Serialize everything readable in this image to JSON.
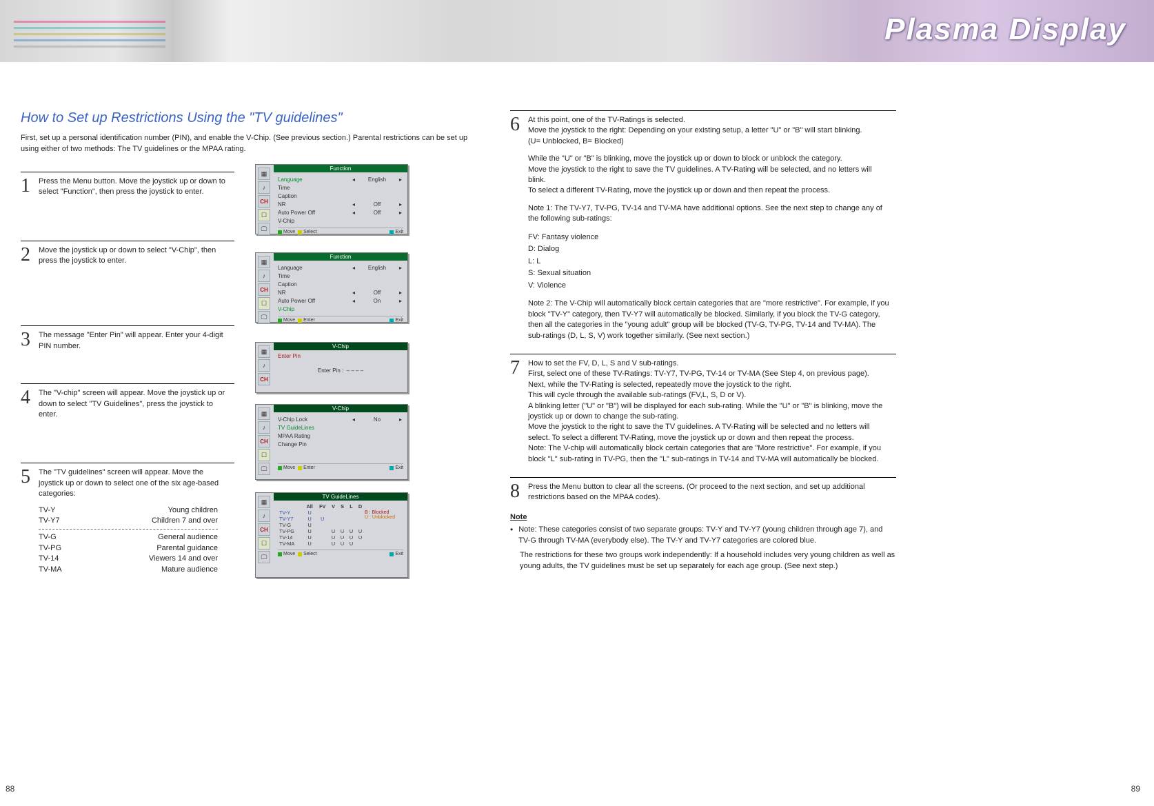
{
  "banner": {
    "title": "Plasma Display"
  },
  "page_left_num": "88",
  "page_right_num": "89",
  "heading": "How to Set up Restrictions Using the \"TV guidelines\"",
  "intro": "First, set up a personal identification number (PIN), and enable the V-Chip. (See previous section.) Parental restrictions can be set up using either of two methods: The TV guidelines or the MPAA rating.",
  "steps": {
    "1": "Press the Menu button. Move the joystick up or down to select \"Function\", then press the joystick to enter.",
    "2": "Move the joystick up or down to select \"V-Chip\", then press the joystick to enter.",
    "3": "The message \"Enter Pin\" will appear. Enter your 4-digit PIN number.",
    "4": "The \"V-chip\" screen will appear. Move the joystick up or down to select \"TV Guidelines\", press the joystick to enter.",
    "5": "The \"TV guidelines\" screen will appear. Move the joystick up or down to select one of the six age-based categories:"
  },
  "ratings": [
    {
      "code": "TV-Y",
      "label": "Young children"
    },
    {
      "code": "TV-Y7",
      "label": "Children 7 and over"
    },
    {
      "code": "TV-G",
      "label": "General audience"
    },
    {
      "code": "TV-PG",
      "label": "Parental guidance"
    },
    {
      "code": "TV-14",
      "label": "Viewers 14 and over"
    },
    {
      "code": "TV-MA",
      "label": "Mature audience"
    }
  ],
  "osd": {
    "icons": {
      "pic": "▦",
      "sound": "♪",
      "ch": "CH",
      "setup": "☐",
      "pc": "🖵"
    },
    "foot": {
      "move": "Move",
      "select": "Select",
      "enter": "Enter",
      "exit": "Exit"
    },
    "func_title": "Function",
    "vchip_title": "V-Chip",
    "guidelines_title": "TV GuideLines",
    "m1": {
      "rows": [
        {
          "lab": "Language",
          "val": "English",
          "hl": true
        },
        {
          "lab": "Time",
          "val": ""
        },
        {
          "lab": "Caption",
          "val": ""
        },
        {
          "lab": "NR",
          "val": "Off"
        },
        {
          "lab": "Auto Power Off",
          "val": "Off"
        },
        {
          "lab": "V-Chip",
          "val": ""
        }
      ]
    },
    "m2": {
      "rows": [
        {
          "lab": "Language",
          "val": "English"
        },
        {
          "lab": "Time",
          "val": ""
        },
        {
          "lab": "Caption",
          "val": ""
        },
        {
          "lab": "NR",
          "val": "Off"
        },
        {
          "lab": "Auto Power Off",
          "val": "On"
        },
        {
          "lab": "V-Chip",
          "val": "",
          "hl": true
        }
      ]
    },
    "m3": {
      "title_tag": "Enter Pin",
      "label": "Enter Pin   :",
      "value": "– – – –"
    },
    "m4": {
      "rows": [
        {
          "lab": "V-Chip Lock",
          "val": "No"
        },
        {
          "lab": "TV GuideLines",
          "val": "",
          "hl": true
        },
        {
          "lab": "MPAA Rating",
          "val": ""
        },
        {
          "lab": "Change Pin",
          "val": ""
        }
      ]
    },
    "m5": {
      "cols": [
        "",
        "All",
        "FV",
        "V",
        "S",
        "L",
        "D"
      ],
      "key_b": "B  : Blocked",
      "key_u": "U  : Unblocked",
      "rows": [
        {
          "r": "TV-Y",
          "all": "U",
          "fv": "",
          "v": "",
          "s": "",
          "l": "",
          "d": "",
          "blue": true
        },
        {
          "r": "TV-Y7",
          "all": "U",
          "fv": "U",
          "v": "",
          "s": "",
          "l": "",
          "d": "",
          "blue": true
        },
        {
          "r": "TV-G",
          "all": "U",
          "fv": "",
          "v": "",
          "s": "",
          "l": "",
          "d": ""
        },
        {
          "r": "TV-PG",
          "all": "U",
          "fv": "",
          "v": "U",
          "s": "U",
          "l": "U",
          "d": "U"
        },
        {
          "r": "TV-14",
          "all": "U",
          "fv": "",
          "v": "U",
          "s": "U",
          "l": "U",
          "d": "U"
        },
        {
          "r": "TV-MA",
          "all": "U",
          "fv": "",
          "v": "U",
          "s": "U",
          "l": "U",
          "d": ""
        }
      ]
    }
  },
  "right": {
    "6": {
      "p1": "At this point, one of the TV-Ratings is selected.",
      "p2": "Move the joystick to the right: Depending on your existing setup, a letter \"U\" or \"B\" will start blinking.",
      "p3": "(U= Unblocked, B= Blocked)",
      "p4": "While the \"U\" or \"B\" is blinking, move the joystick up or down to block or unblock the category.",
      "p5": "Move the joystick to the right to save the TV guidelines. A TV-Rating will be selected, and no letters will blink.",
      "p6": "To select a different TV-Rating, move the joystick up or down and then repeat the process.",
      "p7": "Note 1: The TV-Y7, TV-PG, TV-14 and TV-MA have additional options. See the next step to change any of the following sub-ratings:",
      "subs": [
        "FV: Fantasy violence",
        "D:  Dialog",
        "L:   L",
        "S:  Sexual situation",
        "V:  Violence"
      ],
      "p8": "Note 2: The V-Chip will automatically block certain categories that are \"more restrictive\". For example, if you block \"TV-Y\" category, then TV-Y7 will automatically be blocked. Similarly, if you block the TV-G category, then all the categories in the \"young adult\" group will be blocked (TV-G, TV-PG, TV-14 and TV-MA). The sub-ratings (D, L, S, V) work together similarly. (See next section.)"
    },
    "7": {
      "p1": "How to set the FV, D, L, S and V sub-ratings.",
      "p2": "First, select one of these TV-Ratings: TV-Y7, TV-PG, TV-14 or TV-MA (See Step 4, on previous page).",
      "p3": "Next, while the TV-Rating is selected, repeatedly move the joystick to the right.",
      "p4": "This will cycle through the available sub-ratings (FV,L, S, D or V).",
      "p5": "A blinking letter (\"U\" or \"B\") will be displayed for each sub-rating. While the \"U\" or \"B\" is blinking, move the joystick up or down to change the sub-rating.",
      "p6": "Move the joystick to the right to save the TV guidelines. A TV-Rating will be selected and no letters will select. To select a different TV-Rating, move the joystick up or down and then repeat the process.",
      "p7": "Note: The V-chip will automatically block certain categories that are \"More restrictive\". For example, if you block \"L\" sub-rating in TV-PG, then the \"L\" sub-ratings in TV-14 and TV-MA will automatically be blocked."
    },
    "8": "Press the Menu button  to clear all the screens. (Or proceed to the next section, and set up additional restrictions based on the MPAA codes).",
    "note_head": "Note",
    "note1": "Note: These categories consist of two separate groups: TV-Y and TV-Y7 (young children through age 7), and TV-G through TV-MA (everybody else). The TV-Y and TV-Y7 categories are colored blue.",
    "note2": "The restrictions for these two groups work independently: If a household includes very young children as well as young adults, the TV guidelines must be set up separately for each age group. (See next step.)"
  }
}
